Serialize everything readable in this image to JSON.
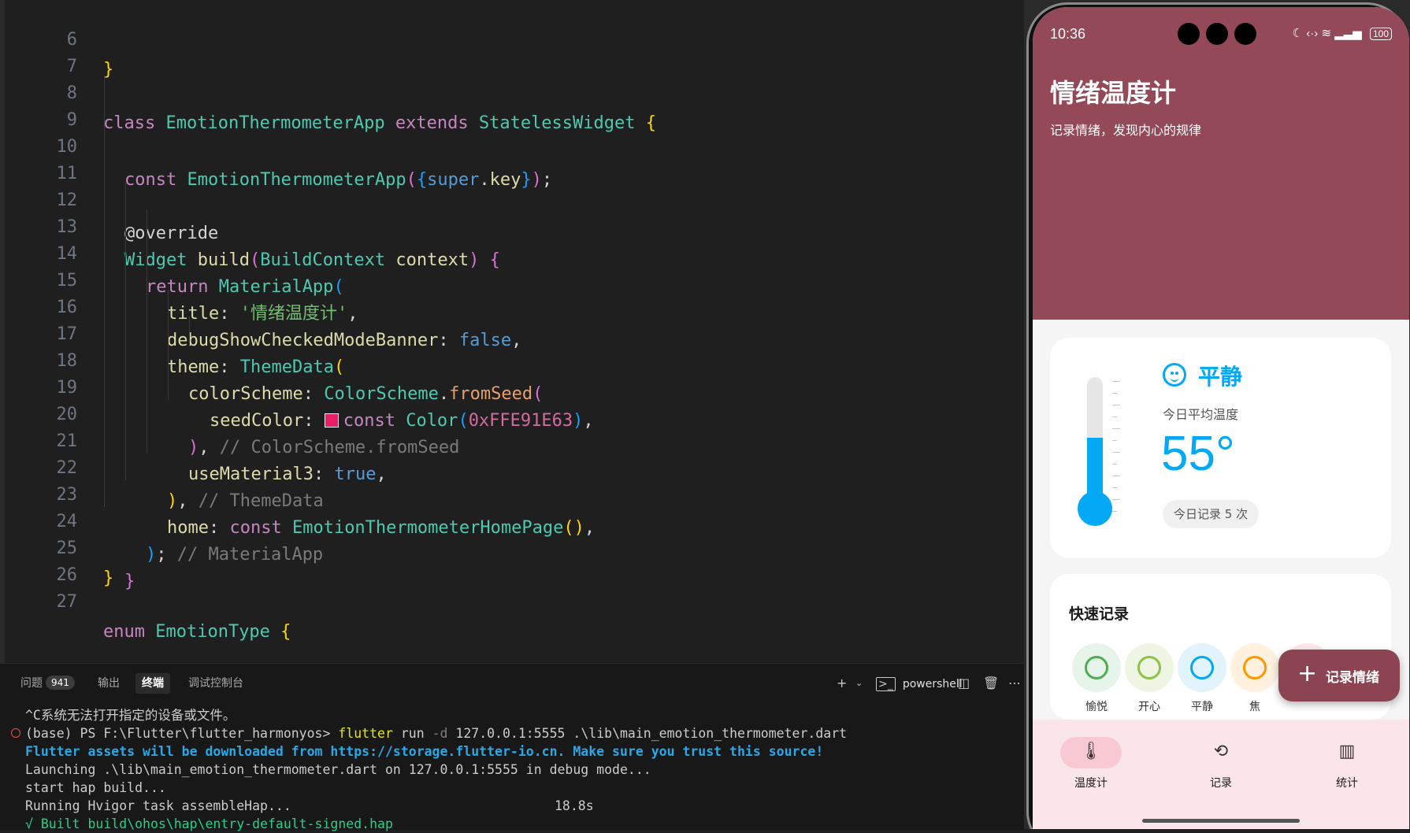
{
  "editor": {
    "lines": [
      {
        "n": "6"
      },
      {
        "n": "7"
      },
      {
        "n": "8"
      },
      {
        "n": "9"
      },
      {
        "n": "10"
      },
      {
        "n": "11"
      },
      {
        "n": "12"
      },
      {
        "n": "13"
      },
      {
        "n": "14"
      },
      {
        "n": "15"
      },
      {
        "n": "16"
      },
      {
        "n": "17"
      },
      {
        "n": "18"
      },
      {
        "n": "19"
      },
      {
        "n": "20"
      },
      {
        "n": "21"
      },
      {
        "n": "22"
      },
      {
        "n": "23"
      },
      {
        "n": "24"
      },
      {
        "n": "25"
      },
      {
        "n": "26"
      },
      {
        "n": "27"
      }
    ],
    "tokens": {
      "l6": [
        "}"
      ],
      "l8": [
        "class",
        " EmotionThermometerApp ",
        "extends",
        " StatelessWidget ",
        "{"
      ],
      "l9": [
        "const",
        " EmotionThermometerApp",
        "(",
        "{",
        "super",
        ".",
        "key",
        "}",
        ")",
        ";"
      ],
      "l11": [
        "@override"
      ],
      "l12": [
        "Widget",
        " build",
        "(",
        "BuildContext",
        " context",
        ")",
        " {"
      ],
      "l13": [
        "return",
        " MaterialApp",
        "("
      ],
      "l14": [
        "title",
        ": ",
        "'情绪温度计'",
        ","
      ],
      "l15": [
        "debugShowCheckedModeBanner",
        ": ",
        "false",
        ","
      ],
      "l16": [
        "theme",
        ": ",
        "ThemeData",
        "("
      ],
      "l17": [
        "colorScheme",
        ": ",
        "ColorScheme",
        ".",
        "fromSeed",
        "("
      ],
      "l18": [
        "seedColor",
        ": ",
        "const",
        " Color",
        "(",
        "0xFFE91E63",
        ")",
        ","
      ],
      "l19": [
        ")",
        ", ",
        "// ColorScheme.fromSeed"
      ],
      "l20": [
        "useMaterial3",
        ": ",
        "true",
        ","
      ],
      "l21": [
        ")",
        ", ",
        "// ThemeData"
      ],
      "l22": [
        "home",
        ": ",
        "const",
        " EmotionThermometerHomePage",
        "()",
        ","
      ],
      "l23": [
        ")",
        "; ",
        "// MaterialApp"
      ],
      "l24": [
        "}"
      ],
      "l25": [
        "}"
      ],
      "l27": [
        "enum",
        " EmotionType ",
        "{"
      ]
    }
  },
  "panel": {
    "tabs": [
      {
        "label": "问题",
        "badge": "941"
      },
      {
        "label": "输出"
      },
      {
        "label": "终端",
        "active": true
      },
      {
        "label": "调试控制台"
      }
    ],
    "shell_label": "powershell",
    "terminal": {
      "l1": "^C系统无法打开指定的设备或文件。",
      "l2_prompt": "(base) PS F:\\Flutter\\flutter_harmonyos> ",
      "l2_cmd": "flutter",
      "l2_run": " run ",
      "l2_flag": "-d",
      "l2_rest": " 127.0.0.1:5555 .\\lib\\main_emotion_thermometer.dart",
      "l3": "Flutter assets will be downloaded from https://storage.flutter-io.cn. Make sure you trust this source!",
      "l4": "Launching .\\lib\\main_emotion_thermometer.dart on 127.0.0.1:5555 in debug mode...",
      "l5": "start hap build...",
      "l6": "Running Hvigor task assembleHap...",
      "l6_time": "18.8s",
      "l7": "√ Built build\\ohos\\hap\\entry-default-signed.hap"
    }
  },
  "phone": {
    "status": {
      "time": "10:36",
      "battery": "100"
    },
    "header": {
      "title": "情绪温度计",
      "subtitle": "记录情绪，发现内心的规律"
    },
    "temp_card": {
      "emotion": "平静",
      "avg_label": "今日平均温度",
      "temperature": "55°",
      "temperature_value": 55,
      "count_label": "今日记录 5 次"
    },
    "quick": {
      "title": "快速记录",
      "items": [
        {
          "label": "愉悦",
          "color": "#4caf50",
          "bg": "#e6f4ea"
        },
        {
          "label": "开心",
          "color": "#8bc34a",
          "bg": "#eef6e3"
        },
        {
          "label": "平静",
          "color": "#03a9f4",
          "bg": "#e1f4fd"
        },
        {
          "label": "焦",
          "color": "#ff9800",
          "bg": "#fff1de"
        },
        {
          "label": "",
          "color": "#f44336",
          "bg": "#fde8e6"
        }
      ]
    },
    "fab": {
      "label": "记录情绪"
    },
    "nav": [
      {
        "label": "温度计",
        "icon": "thermometer-icon",
        "active": true
      },
      {
        "label": "记录",
        "icon": "history-icon"
      },
      {
        "label": "统计",
        "icon": "chart-icon"
      }
    ],
    "colors": {
      "header": "#934957",
      "accent": "#03a9f4",
      "nav_bg": "#fae6ea",
      "nav_pill": "#f8c9d2",
      "fab": "#8c4453"
    }
  }
}
